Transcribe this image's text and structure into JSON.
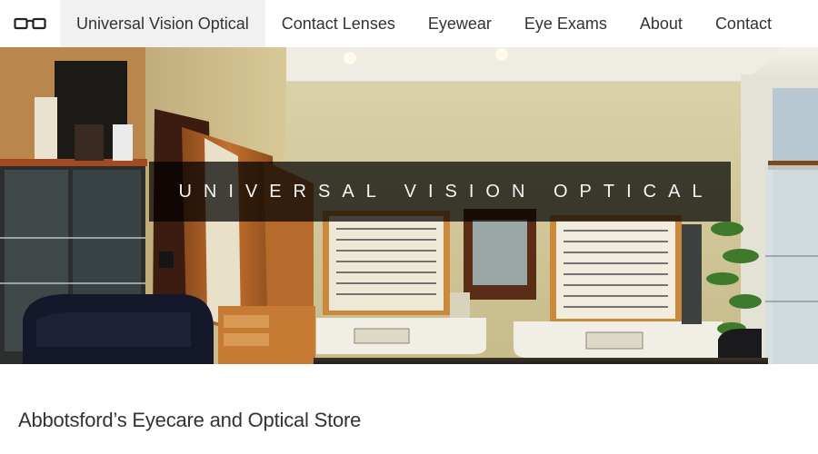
{
  "nav": {
    "logo_icon": "eyeglasses-icon",
    "items": [
      {
        "label": "Universal Vision Optical",
        "active": true
      },
      {
        "label": "Contact Lenses"
      },
      {
        "label": "Eyewear"
      },
      {
        "label": "Eye Exams"
      },
      {
        "label": "About"
      },
      {
        "label": "Contact"
      }
    ]
  },
  "hero": {
    "banner_text": "UNIVERSAL VISION OPTICAL"
  },
  "content": {
    "heading": "Abbotsford’s Eyecare and Optical Store"
  },
  "colors": {
    "nav_bg": "#ffffff",
    "nav_active_bg": "#f1f1f1",
    "banner_bg": "#000000",
    "banner_text": "#f4f4f4"
  }
}
